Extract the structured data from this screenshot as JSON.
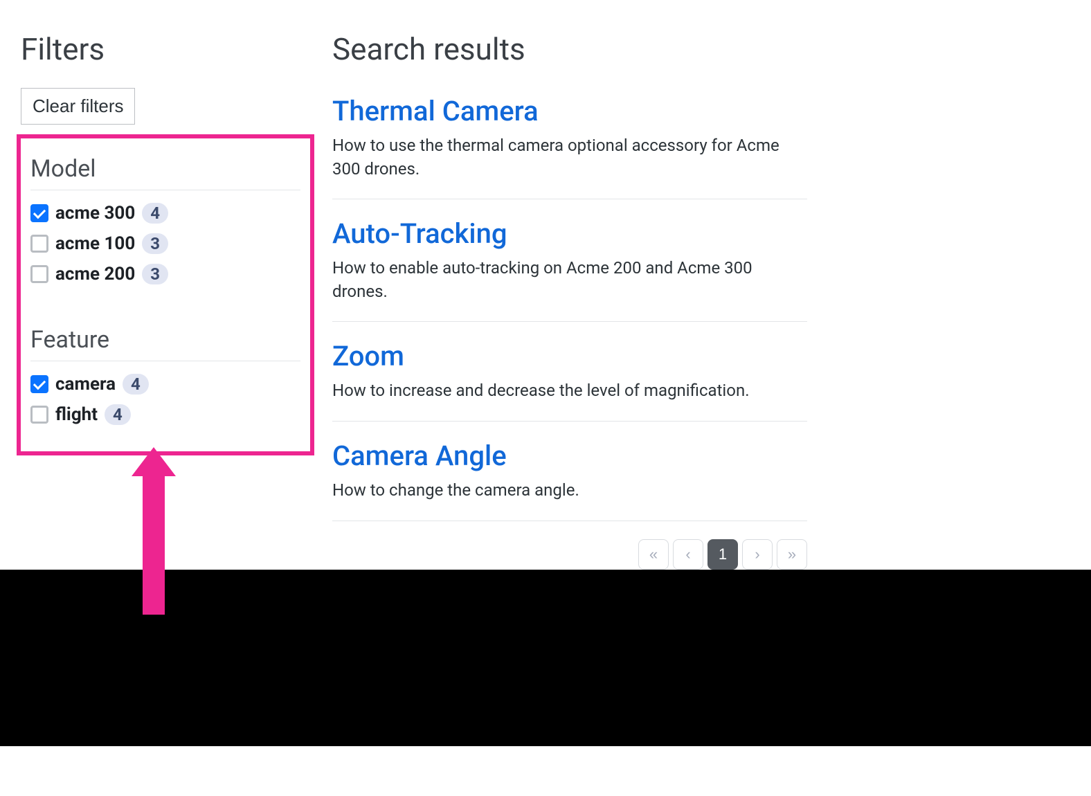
{
  "sidebar": {
    "title": "Filters",
    "clear_label": "Clear filters",
    "groups": [
      {
        "title": "Model",
        "items": [
          {
            "label": "acme 300",
            "count": "4",
            "checked": true
          },
          {
            "label": "acme 100",
            "count": "3",
            "checked": false
          },
          {
            "label": "acme 200",
            "count": "3",
            "checked": false
          }
        ]
      },
      {
        "title": "Feature",
        "items": [
          {
            "label": "camera",
            "count": "4",
            "checked": true
          },
          {
            "label": "flight",
            "count": "4",
            "checked": false
          }
        ]
      }
    ]
  },
  "main": {
    "title": "Search results",
    "results": [
      {
        "title": "Thermal Camera",
        "desc": "How to use the thermal camera optional accessory for Acme 300 drones."
      },
      {
        "title": "Auto-Tracking",
        "desc": "How to enable auto-tracking on Acme 200 and Acme 300 drones."
      },
      {
        "title": "Zoom",
        "desc": "How to increase and decrease the level of magnification."
      },
      {
        "title": "Camera Angle",
        "desc": "How to change the camera angle."
      }
    ],
    "pagination": {
      "first": "«",
      "prev": "‹",
      "pages": [
        "1"
      ],
      "current": "1",
      "next": "›",
      "last": "»"
    }
  },
  "annotation": {
    "highlight_color": "#ed2590"
  }
}
